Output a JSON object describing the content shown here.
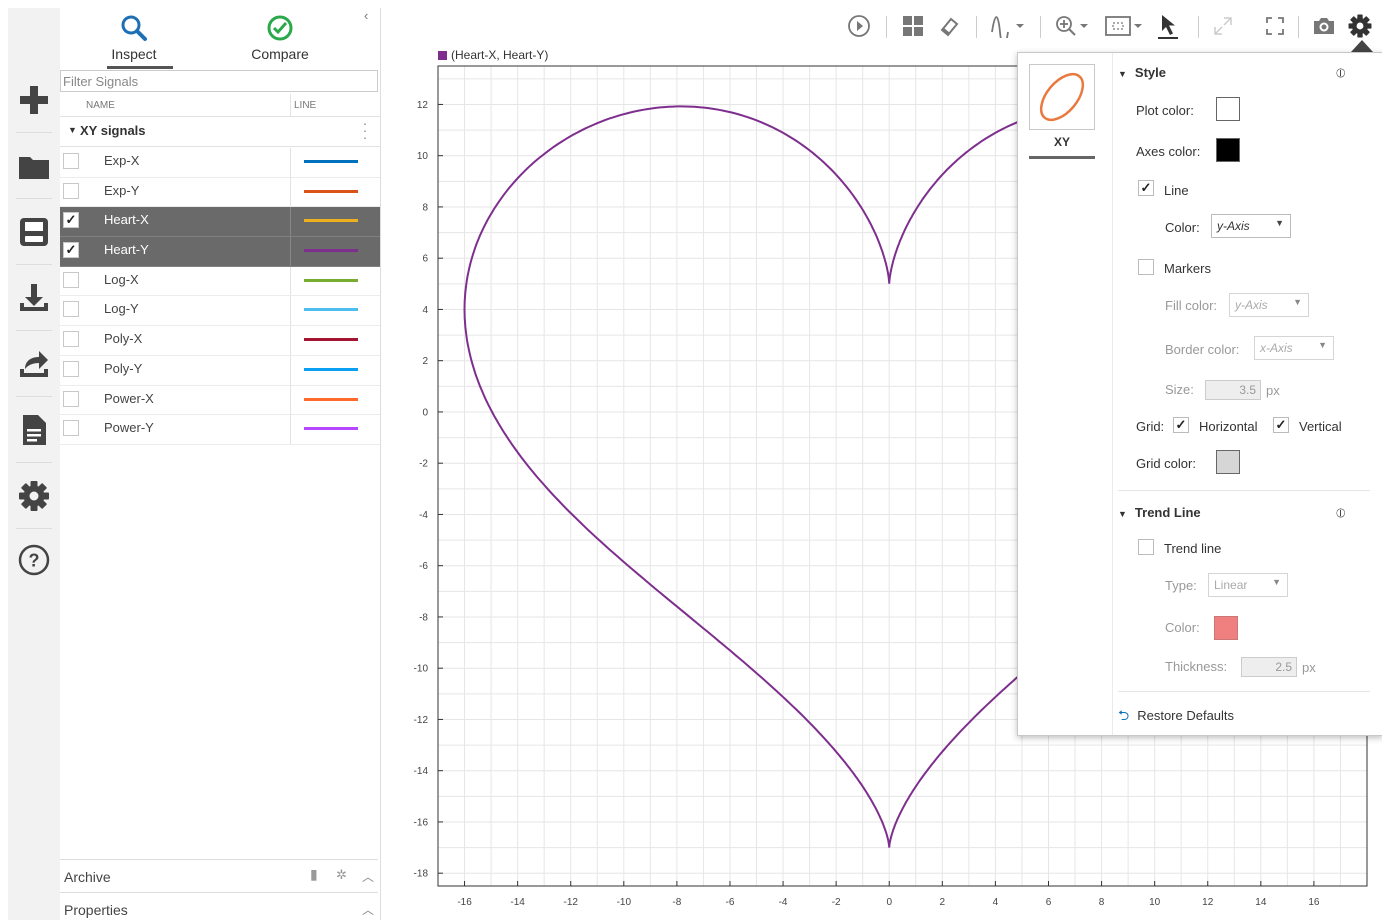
{
  "panel": {
    "tabs": [
      {
        "label": "Inspect"
      },
      {
        "label": "Compare"
      }
    ],
    "filter_placeholder": "Filter Signals",
    "columns": {
      "name": "NAME",
      "line": "LINE"
    },
    "group_label": "XY signals",
    "signals": [
      {
        "name": "Exp-X",
        "checked": false,
        "color": "#0072bd"
      },
      {
        "name": "Exp-Y",
        "checked": false,
        "color": "#d95319"
      },
      {
        "name": "Heart-X",
        "checked": true,
        "color": "#edb120"
      },
      {
        "name": "Heart-Y",
        "checked": true,
        "color": "#7e2f8e"
      },
      {
        "name": "Log-X",
        "checked": false,
        "color": "#77ac30"
      },
      {
        "name": "Log-Y",
        "checked": false,
        "color": "#4dbeee"
      },
      {
        "name": "Poly-X",
        "checked": false,
        "color": "#a2142f"
      },
      {
        "name": "Poly-Y",
        "checked": false,
        "color": "#0b9ff2"
      },
      {
        "name": "Power-X",
        "checked": false,
        "color": "#ff6929"
      },
      {
        "name": "Power-Y",
        "checked": false,
        "color": "#b746ff"
      }
    ],
    "archive_label": "Archive",
    "properties_label": "Properties"
  },
  "plot": {
    "legend": "(Heart-X, Heart-Y)",
    "line_color": "#7e2f8e"
  },
  "chart_data": {
    "type": "line",
    "series": [
      {
        "name": "(Heart-X, Heart-Y)",
        "curve": "heart",
        "x_range": [
          -16,
          16
        ],
        "y_range": [
          -17,
          12
        ]
      }
    ],
    "x_ticks": [
      -16,
      -14,
      -12,
      -10,
      -8,
      -6,
      -4,
      -2,
      0,
      2,
      4,
      6,
      8,
      10,
      12,
      14,
      16
    ],
    "y_ticks": [
      12,
      10,
      8,
      6,
      4,
      2,
      0,
      -2,
      -4,
      -6,
      -8,
      -10,
      -12,
      -14,
      -16,
      -18
    ],
    "xlim": [
      -17,
      18
    ],
    "ylim": [
      -18.5,
      13.5
    ],
    "grid": true
  },
  "popup": {
    "thumb_label": "XY",
    "style_header": "Style",
    "plot_color_label": "Plot color:",
    "plot_color": "#ffffff",
    "axes_color_label": "Axes color:",
    "axes_color": "#000000",
    "line_label": "Line",
    "line_checked": true,
    "line_color_label": "Color:",
    "line_color_value": "y-Axis",
    "markers_label": "Markers",
    "markers_checked": false,
    "fill_color_label": "Fill color:",
    "fill_color_value": "y-Axis",
    "border_color_label": "Border color:",
    "border_color_value": "x-Axis",
    "size_label": "Size:",
    "size_value": "3.5",
    "px": "px",
    "grid_label": "Grid:",
    "grid_horizontal_label": "Horizontal",
    "grid_vertical_label": "Vertical",
    "grid_color_label": "Grid color:",
    "grid_color": "#d6d6d6",
    "trend_header": "Trend Line",
    "trend_line_label": "Trend line",
    "type_label": "Type:",
    "type_value": "Linear",
    "trend_color_label": "Color:",
    "trend_color": "#f08080",
    "thickness_label": "Thickness:",
    "thickness_value": "2.5",
    "restore_label": "Restore Defaults"
  }
}
